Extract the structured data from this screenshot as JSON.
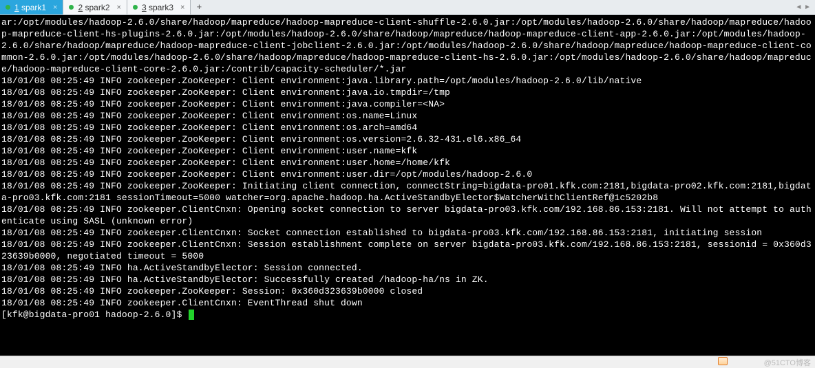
{
  "tabs": [
    {
      "num": "1",
      "label": "spark1",
      "active": true
    },
    {
      "num": "2",
      "label": "spark2",
      "active": false
    },
    {
      "num": "3",
      "label": "spark3",
      "active": false
    }
  ],
  "terminal_lines": [
    "ar:/opt/modules/hadoop-2.6.0/share/hadoop/mapreduce/hadoop-mapreduce-client-shuffle-2.6.0.jar:/opt/modules/hadoop-2.6.0/share/hadoop/mapreduce/hadoop-mapreduce-client-hs-plugins-2.6.0.jar:/opt/modules/hadoop-2.6.0/share/hadoop/mapreduce/hadoop-mapreduce-client-app-2.6.0.jar:/opt/modules/hadoop-2.6.0/share/hadoop/mapreduce/hadoop-mapreduce-client-jobclient-2.6.0.jar:/opt/modules/hadoop-2.6.0/share/hadoop/mapreduce/hadoop-mapreduce-client-common-2.6.0.jar:/opt/modules/hadoop-2.6.0/share/hadoop/mapreduce/hadoop-mapreduce-client-hs-2.6.0.jar:/opt/modules/hadoop-2.6.0/share/hadoop/mapreduce/hadoop-mapreduce-client-core-2.6.0.jar:/contrib/capacity-scheduler/*.jar",
    "18/01/08 08:25:49 INFO zookeeper.ZooKeeper: Client environment:java.library.path=/opt/modules/hadoop-2.6.0/lib/native",
    "18/01/08 08:25:49 INFO zookeeper.ZooKeeper: Client environment:java.io.tmpdir=/tmp",
    "18/01/08 08:25:49 INFO zookeeper.ZooKeeper: Client environment:java.compiler=<NA>",
    "18/01/08 08:25:49 INFO zookeeper.ZooKeeper: Client environment:os.name=Linux",
    "18/01/08 08:25:49 INFO zookeeper.ZooKeeper: Client environment:os.arch=amd64",
    "18/01/08 08:25:49 INFO zookeeper.ZooKeeper: Client environment:os.version=2.6.32-431.el6.x86_64",
    "18/01/08 08:25:49 INFO zookeeper.ZooKeeper: Client environment:user.name=kfk",
    "18/01/08 08:25:49 INFO zookeeper.ZooKeeper: Client environment:user.home=/home/kfk",
    "18/01/08 08:25:49 INFO zookeeper.ZooKeeper: Client environment:user.dir=/opt/modules/hadoop-2.6.0",
    "18/01/08 08:25:49 INFO zookeeper.ZooKeeper: Initiating client connection, connectString=bigdata-pro01.kfk.com:2181,bigdata-pro02.kfk.com:2181,bigdata-pro03.kfk.com:2181 sessionTimeout=5000 watcher=org.apache.hadoop.ha.ActiveStandbyElector$WatcherWithClientRef@1c5202b8",
    "18/01/08 08:25:49 INFO zookeeper.ClientCnxn: Opening socket connection to server bigdata-pro03.kfk.com/192.168.86.153:2181. Will not attempt to authenticate using SASL (unknown error)",
    "18/01/08 08:25:49 INFO zookeeper.ClientCnxn: Socket connection established to bigdata-pro03.kfk.com/192.168.86.153:2181, initiating session",
    "18/01/08 08:25:49 INFO zookeeper.ClientCnxn: Session establishment complete on server bigdata-pro03.kfk.com/192.168.86.153:2181, sessionid = 0x360d323639b0000, negotiated timeout = 5000",
    "18/01/08 08:25:49 INFO ha.ActiveStandbyElector: Session connected.",
    "18/01/08 08:25:49 INFO ha.ActiveStandbyElector: Successfully created /hadoop-ha/ns in ZK.",
    "18/01/08 08:25:49 INFO zookeeper.ZooKeeper: Session: 0x360d323639b0000 closed",
    "18/01/08 08:25:49 INFO zookeeper.ClientCnxn: EventThread shut down"
  ],
  "prompt": "[kfk@bigdata-pro01 hadoop-2.6.0]$ ",
  "watermark": "@51CTO博客",
  "status_left": ""
}
